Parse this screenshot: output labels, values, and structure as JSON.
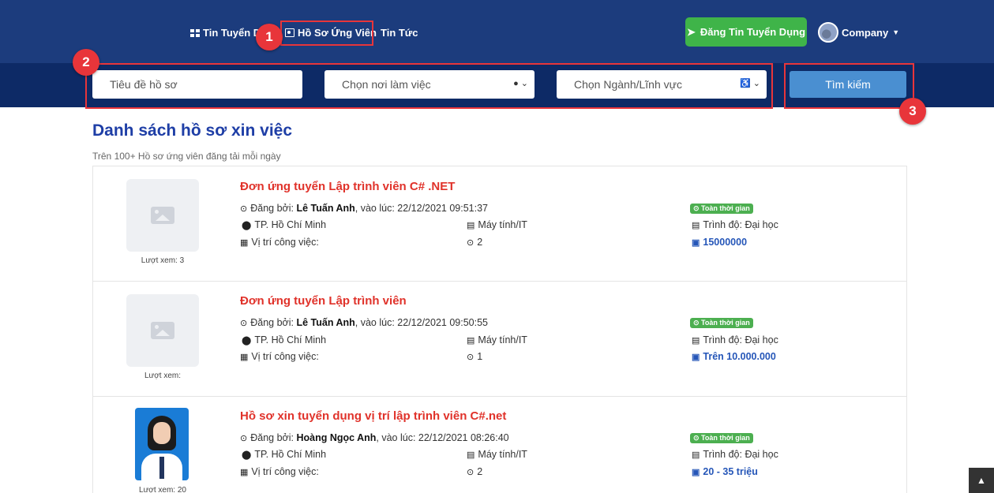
{
  "nav": {
    "jobs_label": "Tin Tuyển D",
    "profiles_label": "Hồ Sơ Ứng Viên",
    "news_label": "Tin Tức",
    "post_job_label": "Đăng Tin Tuyển Dụng",
    "company_label": "Company"
  },
  "search": {
    "title_placeholder": "Tiêu đề hồ sơ",
    "location_placeholder": "Chọn nơi làm việc",
    "industry_placeholder": "Chọn Ngành/Lĩnh vực",
    "button_label": "Tìm kiếm"
  },
  "annotations": [
    "1",
    "2",
    "3"
  ],
  "page": {
    "title": "Danh sách hồ sơ xin việc",
    "subtitle": "Trên 100+ Hồ sơ ứng viên đăng tải mỗi ngày"
  },
  "labels": {
    "posted_by": "Đăng bởi:",
    "at_time": ", vào lúc:",
    "position": "Vị trí công việc:",
    "level_prefix": "Trình độ:"
  },
  "profiles": [
    {
      "title": "Đơn ứng tuyển Lập trình viên C# .NET",
      "author": "Lê Tuấn Anh",
      "datetime": "22/12/2021 09:51:37",
      "location": "TP. Hồ Chí Minh",
      "industry": "Máy tính/IT",
      "count": "2",
      "job_type": "Toàn thời gian",
      "level": "Đại học",
      "salary": "15000000",
      "views": "Lượt xem: 3",
      "has_photo": false
    },
    {
      "title": "Đơn ứng tuyển Lập trình viên",
      "author": "Lê Tuấn Anh",
      "datetime": "22/12/2021 09:50:55",
      "location": "TP. Hồ Chí Minh",
      "industry": "Máy tính/IT",
      "count": "1",
      "job_type": "Toàn thời gian",
      "level": "Đại học",
      "salary": "Trên 10.000.000",
      "views": "Lượt xem:",
      "has_photo": false
    },
    {
      "title": "Hồ sơ xin tuyển dụng vị trí lập trình viên C#.net",
      "author": "Hoàng Ngọc Anh",
      "datetime": "22/12/2021 08:26:40",
      "location": "TP. Hồ Chí Minh",
      "industry": "Máy tính/IT",
      "count": "2",
      "job_type": "Toàn thời gian",
      "level": "Đại học",
      "salary": "20 - 35 triệu",
      "views": "Lượt xem: 20",
      "has_photo": true
    }
  ],
  "icons": [
    "grid-icon",
    "profile-card-icon",
    "paper-plane-icon",
    "caret-down-icon",
    "map-marker-icon",
    "chevron-down-icon",
    "industry-icon",
    "clock-icon",
    "briefcase-icon",
    "id-card-icon",
    "money-icon",
    "image-placeholder-icon",
    "arrow-up-icon"
  ],
  "colors": {
    "nav_bg": "#1c3c7d",
    "search_bg": "#0d2a66",
    "accent_red": "#e0322a",
    "title_blue": "#1e3ea6",
    "green": "#3fb449",
    "search_btn": "#4a8fd1"
  }
}
